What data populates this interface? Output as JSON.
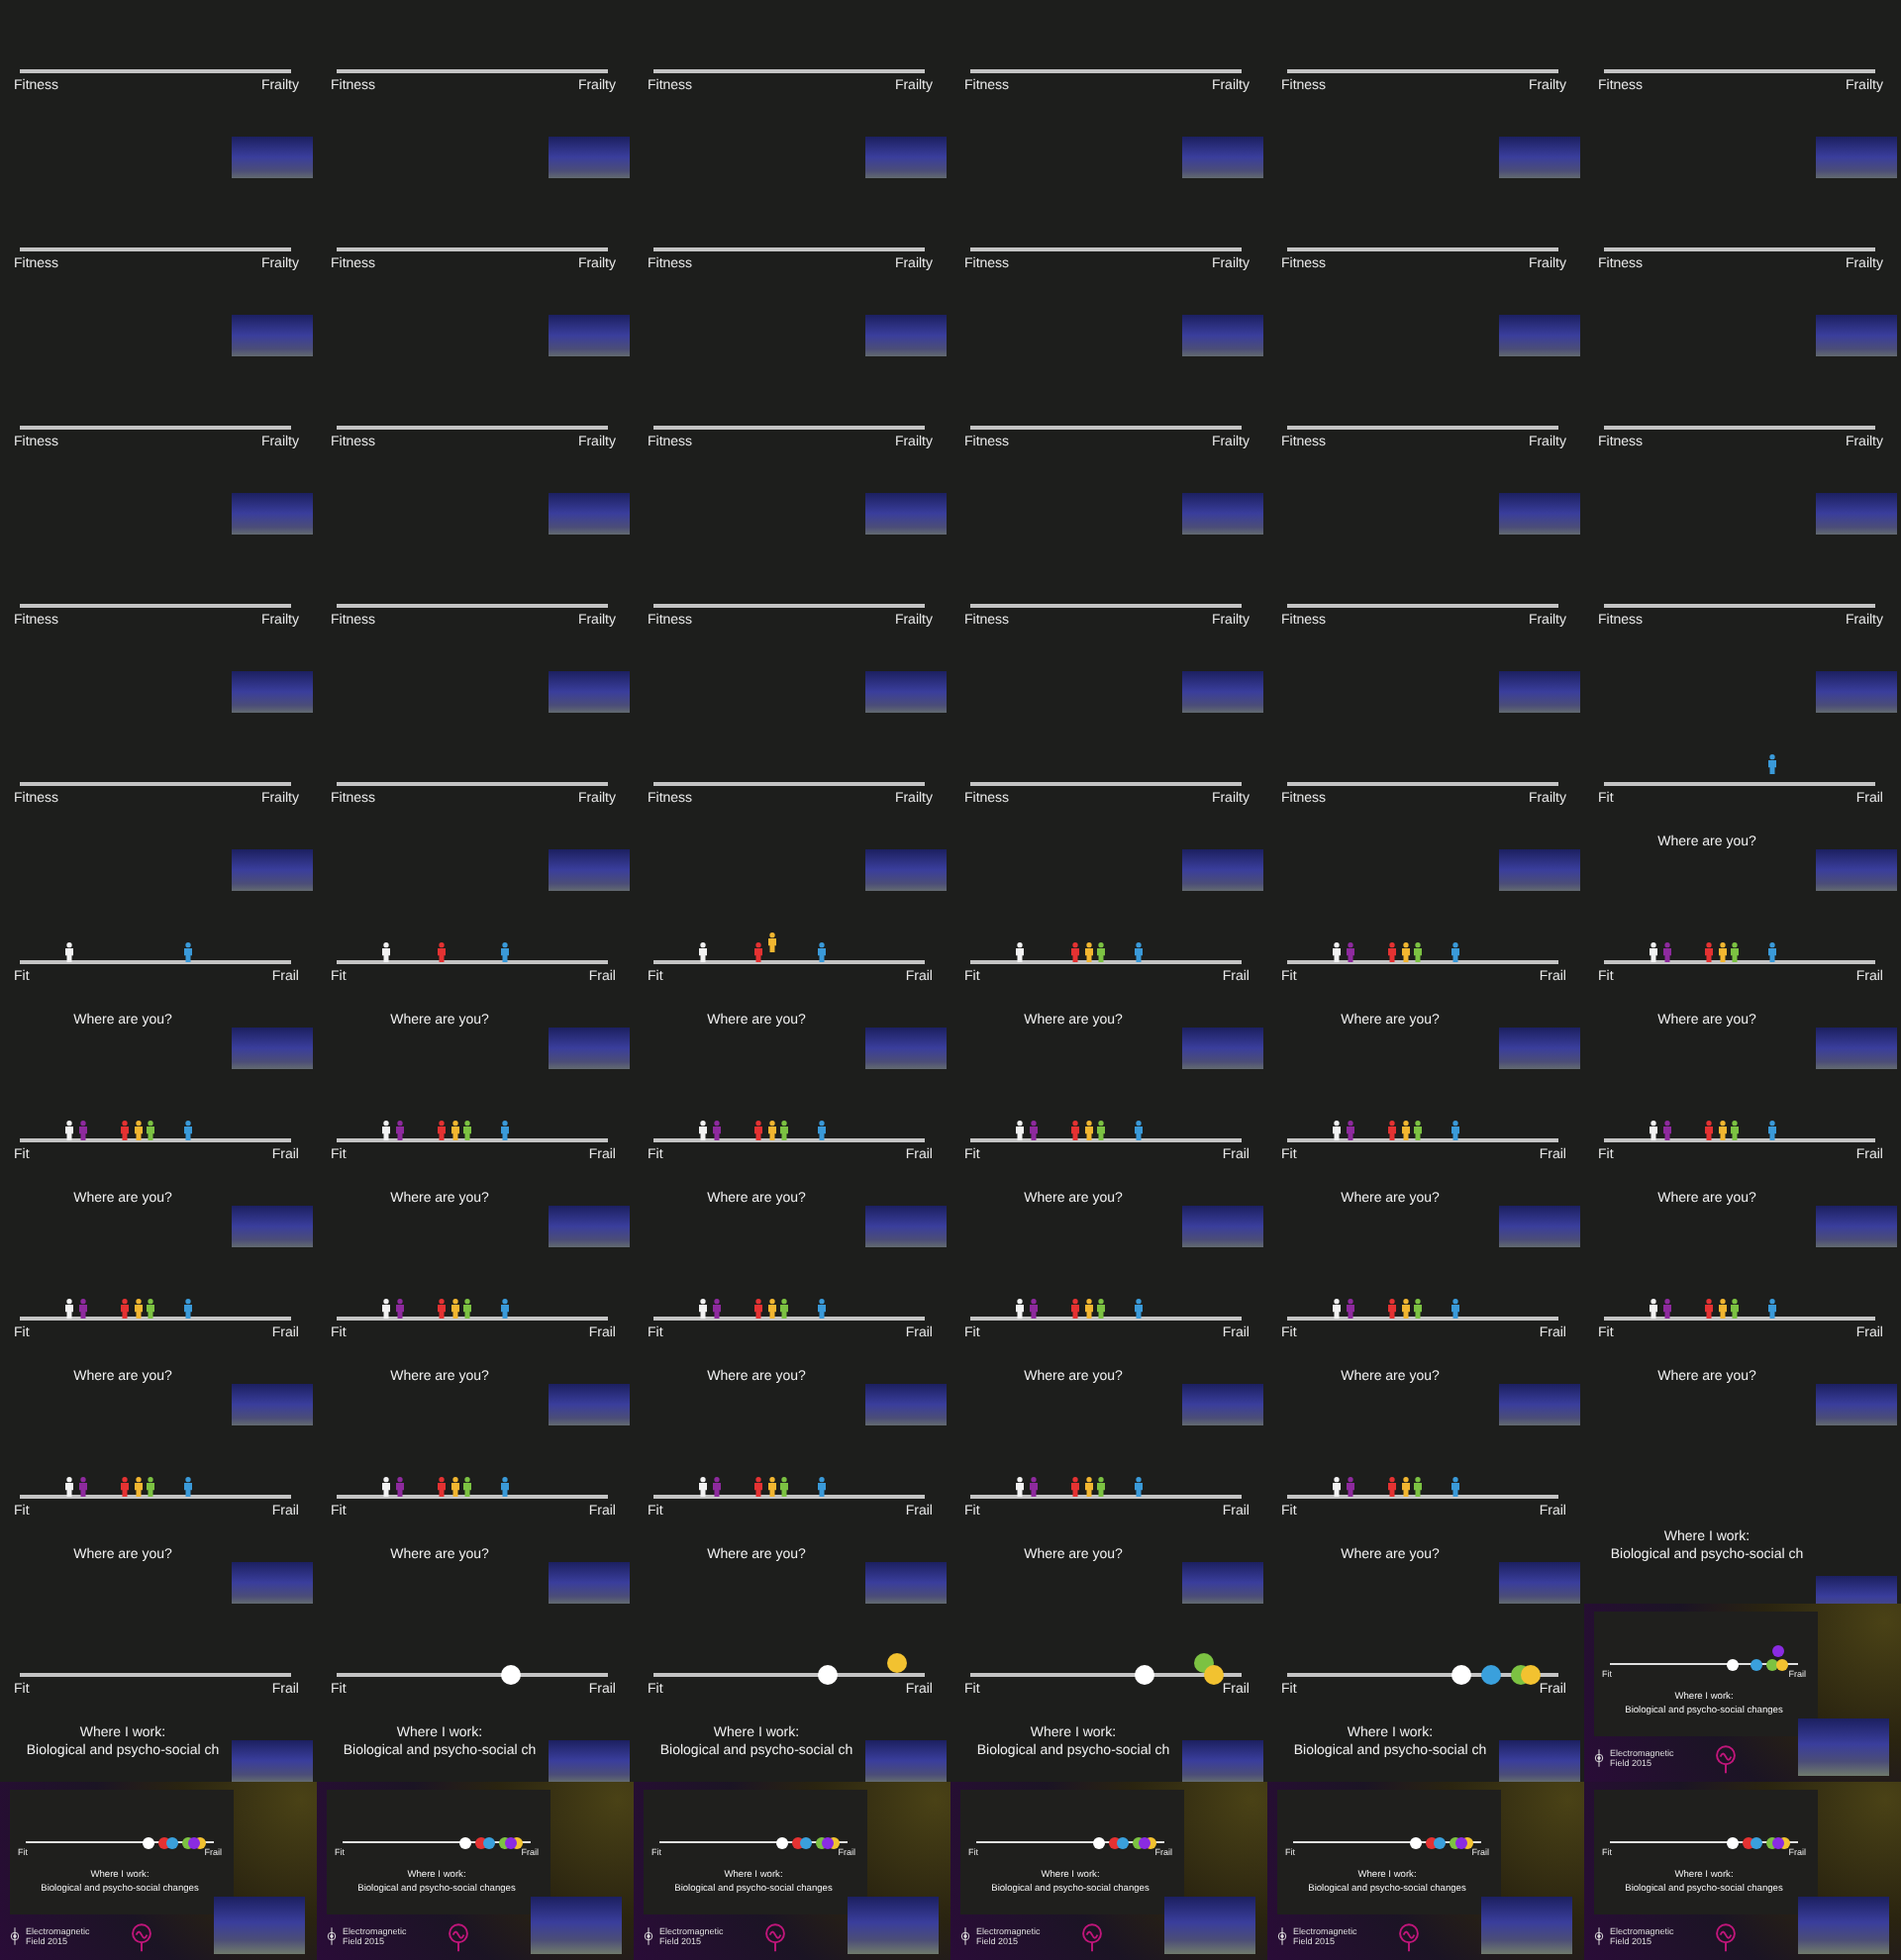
{
  "frames": [
    {
      "kind": "scale",
      "labels": [
        "Fitness",
        "Frailty"
      ]
    },
    {
      "kind": "scale",
      "labels": [
        "Fitness",
        "Frailty"
      ]
    },
    {
      "kind": "scale",
      "labels": [
        "Fitness",
        "Frailty"
      ]
    },
    {
      "kind": "scale",
      "labels": [
        "Fitness",
        "Frailty"
      ]
    },
    {
      "kind": "scale",
      "labels": [
        "Fitness",
        "Frailty"
      ]
    },
    {
      "kind": "scale",
      "labels": [
        "Fitness",
        "Frailty"
      ]
    },
    {
      "kind": "scale",
      "labels": [
        "Fitness",
        "Frailty"
      ]
    },
    {
      "kind": "scale",
      "labels": [
        "Fitness",
        "Frailty"
      ]
    },
    {
      "kind": "scale",
      "labels": [
        "Fitness",
        "Frailty"
      ]
    },
    {
      "kind": "scale",
      "labels": [
        "Fitness",
        "Frailty"
      ]
    },
    {
      "kind": "scale",
      "labels": [
        "Fitness",
        "Frailty"
      ]
    },
    {
      "kind": "scale",
      "labels": [
        "Fitness",
        "Frailty"
      ]
    },
    {
      "kind": "scale",
      "labels": [
        "Fitness",
        "Frailty"
      ]
    },
    {
      "kind": "scale",
      "labels": [
        "Fitness",
        "Frailty"
      ]
    },
    {
      "kind": "scale",
      "labels": [
        "Fitness",
        "Frailty"
      ]
    },
    {
      "kind": "scale",
      "labels": [
        "Fitness",
        "Frailty"
      ]
    },
    {
      "kind": "scale",
      "labels": [
        "Fitness",
        "Frailty"
      ]
    },
    {
      "kind": "scale",
      "labels": [
        "Fitness",
        "Frailty"
      ]
    },
    {
      "kind": "scale",
      "labels": [
        "Fitness",
        "Frailty"
      ]
    },
    {
      "kind": "scale",
      "labels": [
        "Fitness",
        "Frailty"
      ]
    },
    {
      "kind": "scale",
      "labels": [
        "Fitness",
        "Frailty"
      ]
    },
    {
      "kind": "scale",
      "labels": [
        "Fitness",
        "Frailty"
      ]
    },
    {
      "kind": "scale",
      "labels": [
        "Fitness",
        "Frailty"
      ]
    },
    {
      "kind": "scale",
      "labels": [
        "Fitness",
        "Frailty"
      ]
    },
    {
      "kind": "scale",
      "labels": [
        "Fitness",
        "Frailty"
      ]
    },
    {
      "kind": "scale",
      "labels": [
        "Fitness",
        "Frailty"
      ]
    },
    {
      "kind": "scale",
      "labels": [
        "Fitness",
        "Frailty"
      ]
    },
    {
      "kind": "scale",
      "labels": [
        "Fitness",
        "Frailty"
      ]
    },
    {
      "kind": "scale",
      "labels": [
        "Fitness",
        "Frailty"
      ]
    },
    {
      "kind": "scale",
      "labels": [
        "Fit",
        "Frail"
      ],
      "prompt": [
        "Where are you?"
      ],
      "markers": [
        {
          "kind": "figure",
          "color": "#3a9ad9",
          "level": 0.62,
          "raised": true
        }
      ]
    },
    {
      "kind": "scale",
      "labels": [
        "Fit",
        "Frail"
      ],
      "prompt": [
        "Where are you?"
      ],
      "markers": [
        {
          "kind": "figure",
          "color": "#f2f2f2",
          "level": 0.18,
          "raised": false
        },
        {
          "kind": "figure",
          "color": "#3a9ad9",
          "level": 0.62,
          "raised": false
        }
      ]
    },
    {
      "kind": "scale",
      "labels": [
        "Fit",
        "Frail"
      ],
      "prompt": [
        "Where are you?"
      ],
      "markers": [
        {
          "kind": "figure",
          "color": "#f2f2f2",
          "level": 0.18,
          "raised": false
        },
        {
          "kind": "figure",
          "color": "#e53232",
          "level": 0.39,
          "raised": false
        },
        {
          "kind": "figure",
          "color": "#3a9ad9",
          "level": 0.62,
          "raised": false
        }
      ]
    },
    {
      "kind": "scale",
      "labels": [
        "Fit",
        "Frail"
      ],
      "prompt": [
        "Where are you?"
      ],
      "markers": [
        {
          "kind": "figure",
          "color": "#f2f2f2",
          "level": 0.18,
          "raised": false
        },
        {
          "kind": "figure",
          "color": "#e53232",
          "level": 0.39,
          "raised": false
        },
        {
          "kind": "figure",
          "color": "#f2b630",
          "level": 0.44,
          "raised": true
        },
        {
          "kind": "figure",
          "color": "#3a9ad9",
          "level": 0.62,
          "raised": false
        }
      ]
    },
    {
      "kind": "scale",
      "labels": [
        "Fit",
        "Frail"
      ],
      "prompt": [
        "Where are you?"
      ],
      "markers": [
        {
          "kind": "figure",
          "color": "#f2f2f2",
          "level": 0.18,
          "raised": false
        },
        {
          "kind": "figure",
          "color": "#e53232",
          "level": 0.39,
          "raised": false
        },
        {
          "kind": "figure",
          "color": "#f2b630",
          "level": 0.44,
          "raised": false
        },
        {
          "kind": "figure",
          "color": "#7cc242",
          "level": 0.48,
          "raised": false
        },
        {
          "kind": "figure",
          "color": "#3a9ad9",
          "level": 0.62,
          "raised": false
        }
      ]
    },
    {
      "kind": "scale",
      "labels": [
        "Fit",
        "Frail"
      ],
      "prompt": [
        "Where are you?"
      ],
      "markers": [
        {
          "kind": "figure",
          "color": "#f2f2f2",
          "level": 0.18,
          "raised": false
        },
        {
          "kind": "figure",
          "color": "#8e2a9e",
          "level": 0.23,
          "raised": false
        },
        {
          "kind": "figure",
          "color": "#e53232",
          "level": 0.39,
          "raised": false
        },
        {
          "kind": "figure",
          "color": "#f2b630",
          "level": 0.44,
          "raised": false
        },
        {
          "kind": "figure",
          "color": "#7cc242",
          "level": 0.48,
          "raised": false
        },
        {
          "kind": "figure",
          "color": "#3a9ad9",
          "level": 0.62,
          "raised": false
        }
      ]
    },
    {
      "kind": "scale",
      "labels": [
        "Fit",
        "Frail"
      ],
      "prompt": [
        "Where are you?"
      ],
      "markers": [
        {
          "kind": "figure",
          "color": "#f2f2f2",
          "level": 0.18,
          "raised": false
        },
        {
          "kind": "figure",
          "color": "#8e2a9e",
          "level": 0.23,
          "raised": false
        },
        {
          "kind": "figure",
          "color": "#e53232",
          "level": 0.39,
          "raised": false
        },
        {
          "kind": "figure",
          "color": "#f2b630",
          "level": 0.44,
          "raised": false
        },
        {
          "kind": "figure",
          "color": "#7cc242",
          "level": 0.48,
          "raised": false
        },
        {
          "kind": "figure",
          "color": "#3a9ad9",
          "level": 0.62,
          "raised": false
        }
      ]
    },
    {
      "kind": "scale",
      "labels": [
        "Fit",
        "Frail"
      ],
      "prompt": [
        "Where are you?"
      ],
      "markers": [
        {
          "kind": "figure",
          "color": "#f2f2f2",
          "level": 0.18,
          "raised": false
        },
        {
          "kind": "figure",
          "color": "#8e2a9e",
          "level": 0.23,
          "raised": false
        },
        {
          "kind": "figure",
          "color": "#e53232",
          "level": 0.39,
          "raised": false
        },
        {
          "kind": "figure",
          "color": "#f2b630",
          "level": 0.44,
          "raised": false
        },
        {
          "kind": "figure",
          "color": "#7cc242",
          "level": 0.48,
          "raised": false
        },
        {
          "kind": "figure",
          "color": "#3a9ad9",
          "level": 0.62,
          "raised": false
        }
      ]
    },
    {
      "kind": "scale",
      "labels": [
        "Fit",
        "Frail"
      ],
      "prompt": [
        "Where are you?"
      ],
      "markers": [
        {
          "kind": "figure",
          "color": "#f2f2f2",
          "level": 0.18,
          "raised": false
        },
        {
          "kind": "figure",
          "color": "#8e2a9e",
          "level": 0.23,
          "raised": false
        },
        {
          "kind": "figure",
          "color": "#e53232",
          "level": 0.39,
          "raised": false
        },
        {
          "kind": "figure",
          "color": "#f2b630",
          "level": 0.44,
          "raised": false
        },
        {
          "kind": "figure",
          "color": "#7cc242",
          "level": 0.48,
          "raised": false
        },
        {
          "kind": "figure",
          "color": "#3a9ad9",
          "level": 0.62,
          "raised": false
        }
      ]
    },
    {
      "kind": "scale",
      "labels": [
        "Fit",
        "Frail"
      ],
      "prompt": [
        "Where are you?"
      ],
      "markers": [
        {
          "kind": "figure",
          "color": "#f2f2f2",
          "level": 0.18,
          "raised": false
        },
        {
          "kind": "figure",
          "color": "#8e2a9e",
          "level": 0.23,
          "raised": false
        },
        {
          "kind": "figure",
          "color": "#e53232",
          "level": 0.39,
          "raised": false
        },
        {
          "kind": "figure",
          "color": "#f2b630",
          "level": 0.44,
          "raised": false
        },
        {
          "kind": "figure",
          "color": "#7cc242",
          "level": 0.48,
          "raised": false
        },
        {
          "kind": "figure",
          "color": "#3a9ad9",
          "level": 0.62,
          "raised": false
        }
      ]
    },
    {
      "kind": "scale",
      "labels": [
        "Fit",
        "Frail"
      ],
      "prompt": [
        "Where are you?"
      ],
      "markers": [
        {
          "kind": "figure",
          "color": "#f2f2f2",
          "level": 0.18,
          "raised": false
        },
        {
          "kind": "figure",
          "color": "#8e2a9e",
          "level": 0.23,
          "raised": false
        },
        {
          "kind": "figure",
          "color": "#e53232",
          "level": 0.39,
          "raised": false
        },
        {
          "kind": "figure",
          "color": "#f2b630",
          "level": 0.44,
          "raised": false
        },
        {
          "kind": "figure",
          "color": "#7cc242",
          "level": 0.48,
          "raised": false
        },
        {
          "kind": "figure",
          "color": "#3a9ad9",
          "level": 0.62,
          "raised": false
        }
      ]
    },
    {
      "kind": "scale",
      "labels": [
        "Fit",
        "Frail"
      ],
      "prompt": [
        "Where are you?"
      ],
      "markers": [
        {
          "kind": "figure",
          "color": "#f2f2f2",
          "level": 0.18,
          "raised": false
        },
        {
          "kind": "figure",
          "color": "#8e2a9e",
          "level": 0.23,
          "raised": false
        },
        {
          "kind": "figure",
          "color": "#e53232",
          "level": 0.39,
          "raised": false
        },
        {
          "kind": "figure",
          "color": "#f2b630",
          "level": 0.44,
          "raised": false
        },
        {
          "kind": "figure",
          "color": "#7cc242",
          "level": 0.48,
          "raised": false
        },
        {
          "kind": "figure",
          "color": "#3a9ad9",
          "level": 0.62,
          "raised": false
        }
      ]
    },
    {
      "kind": "scale",
      "labels": [
        "Fit",
        "Frail"
      ],
      "prompt": [
        "Where are you?"
      ],
      "markers": [
        {
          "kind": "figure",
          "color": "#f2f2f2",
          "level": 0.18,
          "raised": false
        },
        {
          "kind": "figure",
          "color": "#8e2a9e",
          "level": 0.23,
          "raised": false
        },
        {
          "kind": "figure",
          "color": "#e53232",
          "level": 0.39,
          "raised": false
        },
        {
          "kind": "figure",
          "color": "#f2b630",
          "level": 0.44,
          "raised": false
        },
        {
          "kind": "figure",
          "color": "#7cc242",
          "level": 0.48,
          "raised": false
        },
        {
          "kind": "figure",
          "color": "#3a9ad9",
          "level": 0.62,
          "raised": false
        }
      ]
    },
    {
      "kind": "scale",
      "labels": [
        "Fit",
        "Frail"
      ],
      "prompt": [
        "Where are you?"
      ],
      "markers": [
        {
          "kind": "figure",
          "color": "#f2f2f2",
          "level": 0.18,
          "raised": false
        },
        {
          "kind": "figure",
          "color": "#8e2a9e",
          "level": 0.23,
          "raised": false
        },
        {
          "kind": "figure",
          "color": "#e53232",
          "level": 0.39,
          "raised": false
        },
        {
          "kind": "figure",
          "color": "#f2b630",
          "level": 0.44,
          "raised": false
        },
        {
          "kind": "figure",
          "color": "#7cc242",
          "level": 0.48,
          "raised": false
        },
        {
          "kind": "figure",
          "color": "#3a9ad9",
          "level": 0.62,
          "raised": false
        }
      ]
    },
    {
      "kind": "scale",
      "labels": [
        "Fit",
        "Frail"
      ],
      "prompt": [
        "Where are you?"
      ],
      "markers": [
        {
          "kind": "figure",
          "color": "#f2f2f2",
          "level": 0.18,
          "raised": false
        },
        {
          "kind": "figure",
          "color": "#8e2a9e",
          "level": 0.23,
          "raised": false
        },
        {
          "kind": "figure",
          "color": "#e53232",
          "level": 0.39,
          "raised": false
        },
        {
          "kind": "figure",
          "color": "#f2b630",
          "level": 0.44,
          "raised": false
        },
        {
          "kind": "figure",
          "color": "#7cc242",
          "level": 0.48,
          "raised": false
        },
        {
          "kind": "figure",
          "color": "#3a9ad9",
          "level": 0.62,
          "raised": false
        }
      ]
    },
    {
      "kind": "scale",
      "labels": [
        "Fit",
        "Frail"
      ],
      "prompt": [
        "Where are you?"
      ],
      "markers": [
        {
          "kind": "figure",
          "color": "#f2f2f2",
          "level": 0.18,
          "raised": false
        },
        {
          "kind": "figure",
          "color": "#8e2a9e",
          "level": 0.23,
          "raised": false
        },
        {
          "kind": "figure",
          "color": "#e53232",
          "level": 0.39,
          "raised": false
        },
        {
          "kind": "figure",
          "color": "#f2b630",
          "level": 0.44,
          "raised": false
        },
        {
          "kind": "figure",
          "color": "#7cc242",
          "level": 0.48,
          "raised": false
        },
        {
          "kind": "figure",
          "color": "#3a9ad9",
          "level": 0.62,
          "raised": false
        }
      ]
    },
    {
      "kind": "scale",
      "labels": [
        "Fit",
        "Frail"
      ],
      "prompt": [
        "Where are you?"
      ],
      "markers": [
        {
          "kind": "figure",
          "color": "#f2f2f2",
          "level": 0.18,
          "raised": false
        },
        {
          "kind": "figure",
          "color": "#8e2a9e",
          "level": 0.23,
          "raised": false
        },
        {
          "kind": "figure",
          "color": "#e53232",
          "level": 0.39,
          "raised": false
        },
        {
          "kind": "figure",
          "color": "#f2b630",
          "level": 0.44,
          "raised": false
        },
        {
          "kind": "figure",
          "color": "#7cc242",
          "level": 0.48,
          "raised": false
        },
        {
          "kind": "figure",
          "color": "#3a9ad9",
          "level": 0.62,
          "raised": false
        }
      ]
    },
    {
      "kind": "scale",
      "labels": [
        "Fit",
        "Frail"
      ],
      "prompt": [
        "Where are you?"
      ],
      "markers": [
        {
          "kind": "figure",
          "color": "#f2f2f2",
          "level": 0.18,
          "raised": false
        },
        {
          "kind": "figure",
          "color": "#8e2a9e",
          "level": 0.23,
          "raised": false
        },
        {
          "kind": "figure",
          "color": "#e53232",
          "level": 0.39,
          "raised": false
        },
        {
          "kind": "figure",
          "color": "#f2b630",
          "level": 0.44,
          "raised": false
        },
        {
          "kind": "figure",
          "color": "#7cc242",
          "level": 0.48,
          "raised": false
        },
        {
          "kind": "figure",
          "color": "#3a9ad9",
          "level": 0.62,
          "raised": false
        }
      ]
    },
    {
      "kind": "scale",
      "labels": [
        "Fit",
        "Frail"
      ],
      "prompt": [
        "Where are you?"
      ],
      "markers": [
        {
          "kind": "figure",
          "color": "#f2f2f2",
          "level": 0.18,
          "raised": false
        },
        {
          "kind": "figure",
          "color": "#8e2a9e",
          "level": 0.23,
          "raised": false
        },
        {
          "kind": "figure",
          "color": "#e53232",
          "level": 0.39,
          "raised": false
        },
        {
          "kind": "figure",
          "color": "#f2b630",
          "level": 0.44,
          "raised": false
        },
        {
          "kind": "figure",
          "color": "#7cc242",
          "level": 0.48,
          "raised": false
        },
        {
          "kind": "figure",
          "color": "#3a9ad9",
          "level": 0.62,
          "raised": false
        }
      ]
    },
    {
      "kind": "scale",
      "labels": [
        "Fit",
        "Frail"
      ],
      "prompt": [
        "Where are you?"
      ],
      "markers": [
        {
          "kind": "figure",
          "color": "#f2f2f2",
          "level": 0.18,
          "raised": false
        },
        {
          "kind": "figure",
          "color": "#8e2a9e",
          "level": 0.23,
          "raised": false
        },
        {
          "kind": "figure",
          "color": "#e53232",
          "level": 0.39,
          "raised": false
        },
        {
          "kind": "figure",
          "color": "#f2b630",
          "level": 0.44,
          "raised": false
        },
        {
          "kind": "figure",
          "color": "#7cc242",
          "level": 0.48,
          "raised": false
        },
        {
          "kind": "figure",
          "color": "#3a9ad9",
          "level": 0.62,
          "raised": false
        }
      ]
    },
    {
      "kind": "scale",
      "labels": [
        "Fit",
        "Frail"
      ],
      "prompt": [
        "Where are you?"
      ],
      "markers": [
        {
          "kind": "figure",
          "color": "#f2f2f2",
          "level": 0.18,
          "raised": false
        },
        {
          "kind": "figure",
          "color": "#8e2a9e",
          "level": 0.23,
          "raised": false
        },
        {
          "kind": "figure",
          "color": "#e53232",
          "level": 0.39,
          "raised": false
        },
        {
          "kind": "figure",
          "color": "#f2b630",
          "level": 0.44,
          "raised": false
        },
        {
          "kind": "figure",
          "color": "#7cc242",
          "level": 0.48,
          "raised": false
        },
        {
          "kind": "figure",
          "color": "#3a9ad9",
          "level": 0.62,
          "raised": false
        }
      ]
    },
    {
      "kind": "scale",
      "labels": [
        "Fit",
        "Frail"
      ],
      "prompt": [
        "Where are you?"
      ],
      "markers": [
        {
          "kind": "figure",
          "color": "#f2f2f2",
          "level": 0.18,
          "raised": false
        },
        {
          "kind": "figure",
          "color": "#8e2a9e",
          "level": 0.23,
          "raised": false
        },
        {
          "kind": "figure",
          "color": "#e53232",
          "level": 0.39,
          "raised": false
        },
        {
          "kind": "figure",
          "color": "#f2b630",
          "level": 0.44,
          "raised": false
        },
        {
          "kind": "figure",
          "color": "#7cc242",
          "level": 0.48,
          "raised": false
        },
        {
          "kind": "figure",
          "color": "#3a9ad9",
          "level": 0.62,
          "raised": false
        }
      ]
    },
    {
      "kind": "scale",
      "labels": [
        "Fit",
        "Frail"
      ],
      "prompt": [
        "Where are you?"
      ],
      "markers": [
        {
          "kind": "figure",
          "color": "#f2f2f2",
          "level": 0.18,
          "raised": false
        },
        {
          "kind": "figure",
          "color": "#8e2a9e",
          "level": 0.23,
          "raised": false
        },
        {
          "kind": "figure",
          "color": "#e53232",
          "level": 0.39,
          "raised": false
        },
        {
          "kind": "figure",
          "color": "#f2b630",
          "level": 0.44,
          "raised": false
        },
        {
          "kind": "figure",
          "color": "#7cc242",
          "level": 0.48,
          "raised": false
        },
        {
          "kind": "figure",
          "color": "#3a9ad9",
          "level": 0.62,
          "raised": false
        }
      ]
    },
    {
      "kind": "scale",
      "labels": [
        "Fit",
        "Frail"
      ],
      "prompt": [
        "Where are you?"
      ],
      "markers": [
        {
          "kind": "figure",
          "color": "#f2f2f2",
          "level": 0.18,
          "raised": false
        },
        {
          "kind": "figure",
          "color": "#8e2a9e",
          "level": 0.23,
          "raised": false
        },
        {
          "kind": "figure",
          "color": "#e53232",
          "level": 0.39,
          "raised": false
        },
        {
          "kind": "figure",
          "color": "#f2b630",
          "level": 0.44,
          "raised": false
        },
        {
          "kind": "figure",
          "color": "#7cc242",
          "level": 0.48,
          "raised": false
        },
        {
          "kind": "figure",
          "color": "#3a9ad9",
          "level": 0.62,
          "raised": false
        }
      ]
    },
    {
      "kind": "caption",
      "prompt": [
        "Where I work:",
        "Biological and psycho-social ch"
      ]
    },
    {
      "kind": "scale",
      "labels": [
        "Fit",
        "Frail"
      ],
      "prompt": [
        "Where I work:",
        "Biological and psycho-social ch"
      ]
    },
    {
      "kind": "scale",
      "labels": [
        "Fit",
        "Frail"
      ],
      "prompt": [
        "Where I work:",
        "Biological and psycho-social ch"
      ],
      "markers": [
        {
          "kind": "dot",
          "color": "#ffffff",
          "level": 0.64,
          "raised": false
        }
      ]
    },
    {
      "kind": "scale",
      "labels": [
        "Fit",
        "Frail"
      ],
      "prompt": [
        "Where I work:",
        "Biological and psycho-social ch"
      ],
      "markers": [
        {
          "kind": "dot",
          "color": "#ffffff",
          "level": 0.64,
          "raised": false
        },
        {
          "kind": "dot",
          "color": "#f2c230",
          "level": 0.9,
          "raised": true
        }
      ]
    },
    {
      "kind": "scale",
      "labels": [
        "Fit",
        "Frail"
      ],
      "prompt": [
        "Where I work:",
        "Biological and psycho-social ch"
      ],
      "markers": [
        {
          "kind": "dot",
          "color": "#ffffff",
          "level": 0.64,
          "raised": false
        },
        {
          "kind": "dot",
          "color": "#7cc242",
          "level": 0.86,
          "raised": true
        },
        {
          "kind": "dot",
          "color": "#f2c230",
          "level": 0.9,
          "raised": false
        }
      ]
    },
    {
      "kind": "scale",
      "labels": [
        "Fit",
        "Frail"
      ],
      "prompt": [
        "Where I work:",
        "Biological and psycho-social ch"
      ],
      "markers": [
        {
          "kind": "dot",
          "color": "#ffffff",
          "level": 0.64,
          "raised": false
        },
        {
          "kind": "dot",
          "color": "#3aa0dc",
          "level": 0.75,
          "raised": false
        },
        {
          "kind": "dot",
          "color": "#7cc242",
          "level": 0.86,
          "raised": false
        },
        {
          "kind": "dot",
          "color": "#f2c230",
          "level": 0.9,
          "raised": false
        }
      ]
    },
    {
      "kind": "inset",
      "labels": [
        "Fit",
        "Frail"
      ],
      "prompt": [
        "Where I work:",
        "Biological and psycho-social changes"
      ],
      "footer": [
        "Electromagnetic",
        "Field 2015"
      ],
      "markers": [
        {
          "kind": "dot",
          "color": "#ffffff",
          "level": 0.65,
          "raised": false
        },
        {
          "kind": "dot",
          "color": "#3aa0dc",
          "level": 0.78,
          "raised": false
        },
        {
          "kind": "dot",
          "color": "#7cc242",
          "level": 0.86,
          "raised": false
        },
        {
          "kind": "dot",
          "color": "#f2c230",
          "level": 0.92,
          "raised": false
        },
        {
          "kind": "dot",
          "color": "#8a2be2",
          "level": 0.89,
          "raised": true
        }
      ]
    },
    {
      "kind": "inset",
      "labels": [
        "Fit",
        "Frail"
      ],
      "prompt": [
        "Where I work:",
        "Biological and psycho-social changes"
      ],
      "footer": [
        "Electromagnetic",
        "Field 2015"
      ],
      "markers": [
        {
          "kind": "dot",
          "color": "#ffffff",
          "level": 0.65,
          "raised": false
        },
        {
          "kind": "dot",
          "color": "#e53232",
          "level": 0.74,
          "raised": false
        },
        {
          "kind": "dot",
          "color": "#3aa0dc",
          "level": 0.78,
          "raised": false
        },
        {
          "kind": "dot",
          "color": "#7cc242",
          "level": 0.86,
          "raised": false
        },
        {
          "kind": "dot",
          "color": "#f2c230",
          "level": 0.93,
          "raised": false
        },
        {
          "kind": "dot",
          "color": "#8a2be2",
          "level": 0.89,
          "raised": false
        }
      ]
    },
    {
      "kind": "inset",
      "labels": [
        "Fit",
        "Frail"
      ],
      "prompt": [
        "Where I work:",
        "Biological and psycho-social changes"
      ],
      "footer": [
        "Electromagnetic",
        "Field 2015"
      ],
      "markers": [
        {
          "kind": "dot",
          "color": "#ffffff",
          "level": 0.65,
          "raised": false
        },
        {
          "kind": "dot",
          "color": "#e53232",
          "level": 0.74,
          "raised": false
        },
        {
          "kind": "dot",
          "color": "#3aa0dc",
          "level": 0.78,
          "raised": false
        },
        {
          "kind": "dot",
          "color": "#7cc242",
          "level": 0.86,
          "raised": false
        },
        {
          "kind": "dot",
          "color": "#f2c230",
          "level": 0.93,
          "raised": false
        },
        {
          "kind": "dot",
          "color": "#8a2be2",
          "level": 0.89,
          "raised": false
        }
      ]
    },
    {
      "kind": "inset",
      "labels": [
        "Fit",
        "Frail"
      ],
      "prompt": [
        "Where I work:",
        "Biological and psycho-social changes"
      ],
      "footer": [
        "Electromagnetic",
        "Field 2015"
      ],
      "markers": [
        {
          "kind": "dot",
          "color": "#ffffff",
          "level": 0.65,
          "raised": false
        },
        {
          "kind": "dot",
          "color": "#e53232",
          "level": 0.74,
          "raised": false
        },
        {
          "kind": "dot",
          "color": "#3aa0dc",
          "level": 0.78,
          "raised": false
        },
        {
          "kind": "dot",
          "color": "#7cc242",
          "level": 0.86,
          "raised": false
        },
        {
          "kind": "dot",
          "color": "#f2c230",
          "level": 0.93,
          "raised": false
        },
        {
          "kind": "dot",
          "color": "#8a2be2",
          "level": 0.89,
          "raised": false
        }
      ]
    },
    {
      "kind": "inset",
      "labels": [
        "Fit",
        "Frail"
      ],
      "prompt": [
        "Where I work:",
        "Biological and psycho-social changes"
      ],
      "footer": [
        "Electromagnetic",
        "Field 2015"
      ],
      "markers": [
        {
          "kind": "dot",
          "color": "#ffffff",
          "level": 0.65,
          "raised": false
        },
        {
          "kind": "dot",
          "color": "#e53232",
          "level": 0.74,
          "raised": false
        },
        {
          "kind": "dot",
          "color": "#3aa0dc",
          "level": 0.78,
          "raised": false
        },
        {
          "kind": "dot",
          "color": "#7cc242",
          "level": 0.86,
          "raised": false
        },
        {
          "kind": "dot",
          "color": "#f2c230",
          "level": 0.93,
          "raised": false
        },
        {
          "kind": "dot",
          "color": "#8a2be2",
          "level": 0.89,
          "raised": false
        }
      ]
    },
    {
      "kind": "inset",
      "labels": [
        "Fit",
        "Frail"
      ],
      "prompt": [
        "Where I work:",
        "Biological and psycho-social changes"
      ],
      "footer": [
        "Electromagnetic",
        "Field 2015"
      ],
      "markers": [
        {
          "kind": "dot",
          "color": "#ffffff",
          "level": 0.65,
          "raised": false
        },
        {
          "kind": "dot",
          "color": "#e53232",
          "level": 0.74,
          "raised": false
        },
        {
          "kind": "dot",
          "color": "#3aa0dc",
          "level": 0.78,
          "raised": false
        },
        {
          "kind": "dot",
          "color": "#7cc242",
          "level": 0.86,
          "raised": false
        },
        {
          "kind": "dot",
          "color": "#f2c230",
          "level": 0.93,
          "raised": false
        },
        {
          "kind": "dot",
          "color": "#8a2be2",
          "level": 0.89,
          "raised": false
        }
      ]
    },
    {
      "kind": "inset",
      "labels": [
        "Fit",
        "Frail"
      ],
      "prompt": [
        "Where I work:",
        "Biological and psycho-social changes"
      ],
      "footer": [
        "Electromagnetic",
        "Field 2015"
      ],
      "markers": [
        {
          "kind": "dot",
          "color": "#ffffff",
          "level": 0.65,
          "raised": false
        },
        {
          "kind": "dot",
          "color": "#e53232",
          "level": 0.74,
          "raised": false
        },
        {
          "kind": "dot",
          "color": "#3aa0dc",
          "level": 0.78,
          "raised": false
        },
        {
          "kind": "dot",
          "color": "#7cc242",
          "level": 0.86,
          "raised": false
        },
        {
          "kind": "dot",
          "color": "#f2c230",
          "level": 0.93,
          "raised": false
        },
        {
          "kind": "dot",
          "color": "#8a2be2",
          "level": 0.89,
          "raised": false
        }
      ]
    }
  ]
}
